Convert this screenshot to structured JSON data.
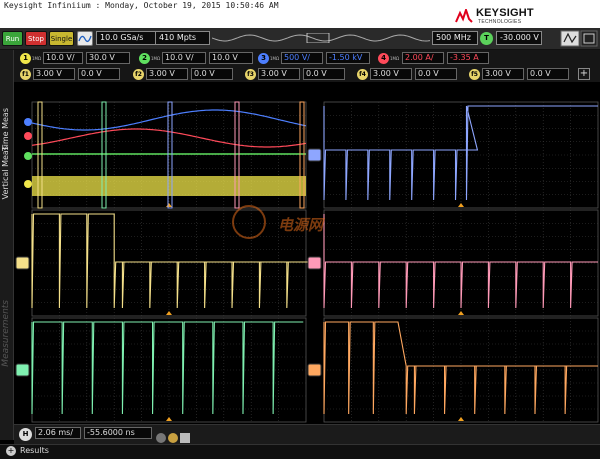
{
  "titlebar": {
    "title": "Keysight Infiniium : Monday, October 19, 2015 10:50:46 AM",
    "brand": "KEYSIGHT",
    "brand_sub": "TECHNOLOGIES"
  },
  "toolbar": {
    "run_label": "Run",
    "stop_label": "Stop",
    "single_label": "Single",
    "sample_rate": "10.0 GSa/s",
    "memory_depth": "410 Mpts",
    "bandwidth": "500 MHz",
    "trigger_badge": "T",
    "trigger_level": "-30.000 V"
  },
  "channels": [
    {
      "num": "1",
      "color": "#f0e64a",
      "impedance": "1MΩ",
      "scale": "10.0 V/",
      "offset": "30.0 V"
    },
    {
      "num": "2",
      "color": "#5fe05f",
      "impedance": "1MΩ",
      "scale": "10.0 V/",
      "offset": "10.0 V"
    },
    {
      "num": "3",
      "color": "#4d7fff",
      "impedance": "1MΩ",
      "scale": "500 V/",
      "offset": "-1.50 kV"
    },
    {
      "num": "4",
      "color": "#ff4a5a",
      "impedance": "1MΩ",
      "scale": "2.00 A/",
      "offset": "-3.35 A"
    }
  ],
  "math_functions": [
    {
      "badge": "f1",
      "scale": "3.00 V",
      "offset": "0.0 V"
    },
    {
      "badge": "f2",
      "scale": "3.00 V",
      "offset": "0.0 V"
    },
    {
      "badge": "f3",
      "scale": "3.00 V",
      "offset": "0.0 V"
    },
    {
      "badge": "f4",
      "scale": "3.00 V",
      "offset": "0.0 V"
    },
    {
      "badge": "f5",
      "scale": "3.00 V",
      "offset": "0.0 V"
    }
  ],
  "side_tabs": {
    "time_meas": "Time Meas",
    "vertical_meas": "Vertical Meas",
    "measurements": "Measurements"
  },
  "watermark": "电源网",
  "horizontal": {
    "badge": "H",
    "scale": "2.06 ms/",
    "position": "-55.6000 ns"
  },
  "status": {
    "results_label": "Results"
  },
  "colors": {
    "ch1": "#f0e64a",
    "ch2": "#5fe05f",
    "ch3": "#4d7fff",
    "ch4": "#ff4a5a",
    "zoom_blue": "#8ea6ff",
    "zoom_yellow": "#f4e08a",
    "zoom_pink": "#ff9ab8",
    "zoom_green": "#7ff0b0",
    "zoom_orange": "#ffa860",
    "grid": "#3a3a3a"
  }
}
